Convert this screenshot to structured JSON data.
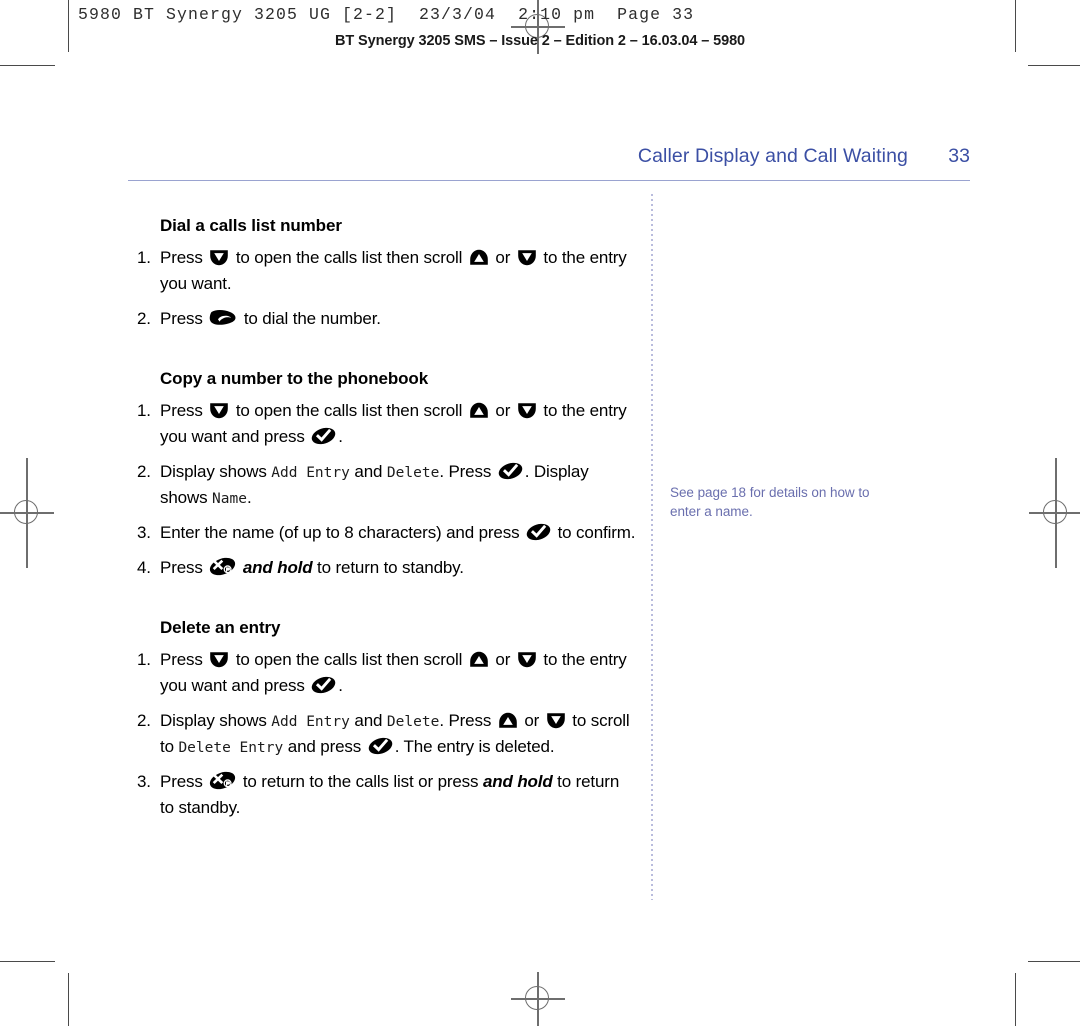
{
  "printer_marks": {
    "slug_line": "5980 BT Synergy 3205 UG [2-2]  23/3/04  2:10 pm  Page 33",
    "edition_line": "BT Synergy 3205 SMS – Issue 2 – Edition 2 – 16.03.04 – 5980"
  },
  "header": {
    "title": "Caller Display and Call Waiting",
    "page_number": "33",
    "color": "#3b4fa4",
    "rule_color": "#9aa3d0"
  },
  "sections": [
    {
      "id": "dial-a-calls-list-number",
      "title": "Dial a calls list number",
      "steps": [
        {
          "num": "1.",
          "parts": [
            {
              "t": "text",
              "v": "Press "
            },
            {
              "t": "icon",
              "v": "down-arrow-key-icon"
            },
            {
              "t": "text",
              "v": " to open the calls list then scroll "
            },
            {
              "t": "icon",
              "v": "up-arrow-key-icon"
            },
            {
              "t": "text",
              "v": " or "
            },
            {
              "t": "icon",
              "v": "down-arrow-key-icon"
            },
            {
              "t": "text",
              "v": " to the entry you want."
            }
          ]
        },
        {
          "num": "2.",
          "parts": [
            {
              "t": "text",
              "v": "Press "
            },
            {
              "t": "icon",
              "v": "phone-handset-key-icon"
            },
            {
              "t": "text",
              "v": " to dial the number."
            }
          ]
        }
      ]
    },
    {
      "id": "copy-a-number-to-the-phonebook",
      "title": "Copy a number to the phonebook",
      "steps": [
        {
          "num": "1.",
          "parts": [
            {
              "t": "text",
              "v": "Press "
            },
            {
              "t": "icon",
              "v": "down-arrow-key-icon"
            },
            {
              "t": "text",
              "v": " to open the calls list then scroll "
            },
            {
              "t": "icon",
              "v": "up-arrow-key-icon"
            },
            {
              "t": "text",
              "v": " or "
            },
            {
              "t": "icon",
              "v": "down-arrow-key-icon"
            },
            {
              "t": "text",
              "v": " to the entry you want and press "
            },
            {
              "t": "icon",
              "v": "tick-key-icon"
            },
            {
              "t": "text",
              "v": "."
            }
          ]
        },
        {
          "num": "2.",
          "parts": [
            {
              "t": "text",
              "v": "Display shows "
            },
            {
              "t": "lcd",
              "v": "Add Entry"
            },
            {
              "t": "text",
              "v": " and "
            },
            {
              "t": "lcd",
              "v": "Delete"
            },
            {
              "t": "text",
              "v": ". Press "
            },
            {
              "t": "icon",
              "v": "tick-key-icon"
            },
            {
              "t": "text",
              "v": ". Display shows "
            },
            {
              "t": "lcd",
              "v": "Name"
            },
            {
              "t": "text",
              "v": "."
            }
          ]
        },
        {
          "num": "3.",
          "parts": [
            {
              "t": "text",
              "v": "Enter the name (of up to 8 characters) and press "
            },
            {
              "t": "icon",
              "v": "tick-key-icon"
            },
            {
              "t": "text",
              "v": " to confirm."
            }
          ]
        },
        {
          "num": "4.",
          "parts": [
            {
              "t": "text",
              "v": "Press "
            },
            {
              "t": "icon",
              "v": "end-call-key-icon"
            },
            {
              "t": "text",
              "v": " "
            },
            {
              "t": "bolditalic",
              "v": "and hold"
            },
            {
              "t": "text",
              "v": " to return to standby."
            }
          ]
        }
      ]
    },
    {
      "id": "delete-an-entry",
      "title": "Delete an entry",
      "steps": [
        {
          "num": "1.",
          "parts": [
            {
              "t": "text",
              "v": "Press "
            },
            {
              "t": "icon",
              "v": "down-arrow-key-icon"
            },
            {
              "t": "text",
              "v": " to open the calls list then scroll "
            },
            {
              "t": "icon",
              "v": "up-arrow-key-icon"
            },
            {
              "t": "text",
              "v": " or "
            },
            {
              "t": "icon",
              "v": "down-arrow-key-icon"
            },
            {
              "t": "text",
              "v": " to the entry you want and press "
            },
            {
              "t": "icon",
              "v": "tick-key-icon"
            },
            {
              "t": "text",
              "v": "."
            }
          ]
        },
        {
          "num": "2.",
          "parts": [
            {
              "t": "text",
              "v": "Display shows "
            },
            {
              "t": "lcd",
              "v": "Add Entry"
            },
            {
              "t": "text",
              "v": " and "
            },
            {
              "t": "lcd",
              "v": "Delete"
            },
            {
              "t": "text",
              "v": ". Press "
            },
            {
              "t": "icon",
              "v": "up-arrow-key-icon"
            },
            {
              "t": "text",
              "v": " or "
            },
            {
              "t": "icon",
              "v": "down-arrow-key-icon"
            },
            {
              "t": "text",
              "v": " to scroll to "
            },
            {
              "t": "lcd",
              "v": "Delete Entry"
            },
            {
              "t": "text",
              "v": " and press "
            },
            {
              "t": "icon",
              "v": "tick-key-icon"
            },
            {
              "t": "text",
              "v": ". The entry is deleted."
            }
          ]
        },
        {
          "num": "3.",
          "parts": [
            {
              "t": "text",
              "v": "Press "
            },
            {
              "t": "icon",
              "v": "end-call-key-icon"
            },
            {
              "t": "text",
              "v": " to return to the calls list or press "
            },
            {
              "t": "bolditalic",
              "v": "and hold"
            },
            {
              "t": "text",
              "v": " to return to standby."
            }
          ]
        }
      ]
    }
  ],
  "margin_note": {
    "text": "See page 18 for details on how to enter a name.",
    "color": "#6a6fae"
  }
}
